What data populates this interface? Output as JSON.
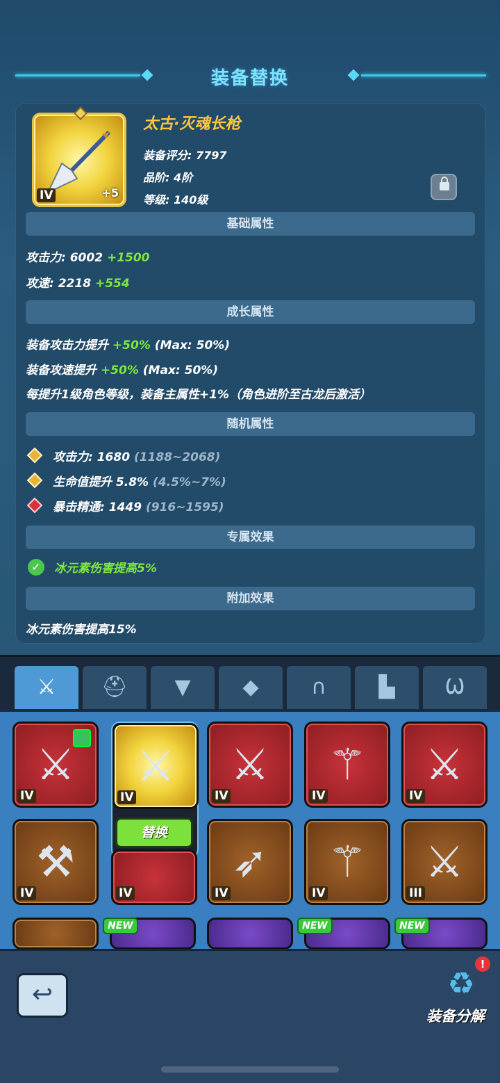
{
  "header": {
    "title": "装备替换"
  },
  "item": {
    "name": "太古·灭魂长枪",
    "tier": "IV",
    "enhance": "+5",
    "score": "装备评分: 7797",
    "grade": "品阶: 4阶",
    "level": "等级: 140级"
  },
  "sections": {
    "base": "基础属性",
    "growth": "成长属性",
    "random": "随机属性",
    "exclusive": "专属效果",
    "extra": "附加效果"
  },
  "base_stats": [
    {
      "label": "攻击力: 6002",
      "bonus": "+1500"
    },
    {
      "label": "攻速: 2218",
      "bonus": "+554"
    }
  ],
  "growth_stats": [
    {
      "label": "装备攻击力提升",
      "bonus": "+50%",
      "max": "(Max: 50%)"
    },
    {
      "label": "装备攻速提升",
      "bonus": "+50%",
      "max": "(Max: 50%)"
    },
    {
      "label": "每提升1级角色等级，装备主属性+1%（角色进阶至古龙后激活）"
    }
  ],
  "random_stats": [
    {
      "label": "攻击力: 1680",
      "range": "(1188~2068)",
      "color": "gold"
    },
    {
      "label": "生命值提升 5.8%",
      "range": "(4.5%~7%)",
      "color": "gold"
    },
    {
      "label": "暴击精通: 1449",
      "range": "(916~1595)",
      "color": "red"
    }
  ],
  "exclusive_effect": "冰元素伤害提高5%",
  "extra_effect": "冰元素伤害提高15%",
  "tabs": [
    {
      "icon": "sword-icon",
      "glyph": "⚔"
    },
    {
      "icon": "helmet-icon",
      "glyph": "⛑"
    },
    {
      "icon": "armor-icon",
      "glyph": "👕"
    },
    {
      "icon": "bracer-icon",
      "glyph": "🛡"
    },
    {
      "icon": "pants-icon",
      "glyph": "▥"
    },
    {
      "icon": "boots-icon",
      "glyph": "👢"
    },
    {
      "icon": "necklace-icon",
      "glyph": "⚓"
    }
  ],
  "grid": {
    "replace_label": "替换",
    "new_label": "NEW",
    "cards": [
      {
        "tier": "IV",
        "rarity": "red",
        "glyph": "⚔"
      },
      {
        "tier": "IV",
        "rarity": "gold",
        "glyph": "⚔"
      },
      {
        "tier": "IV",
        "rarity": "red",
        "glyph": "⚔"
      },
      {
        "tier": "IV",
        "rarity": "red",
        "glyph": "⚚"
      },
      {
        "tier": "IV",
        "rarity": "red",
        "glyph": "⚔"
      },
      {
        "tier": "IV",
        "rarity": "brown",
        "glyph": "⚒"
      },
      {
        "tier": "IV",
        "rarity": "red",
        "glyph": "⚔"
      },
      {
        "tier": "IV",
        "rarity": "brown",
        "glyph": "➶"
      },
      {
        "tier": "IV",
        "rarity": "brown",
        "glyph": "⚚"
      },
      {
        "tier": "III",
        "rarity": "brown",
        "glyph": "⚔"
      }
    ]
  },
  "bottom": {
    "recycle_label": "装备分解",
    "recycle_badge": "!"
  }
}
